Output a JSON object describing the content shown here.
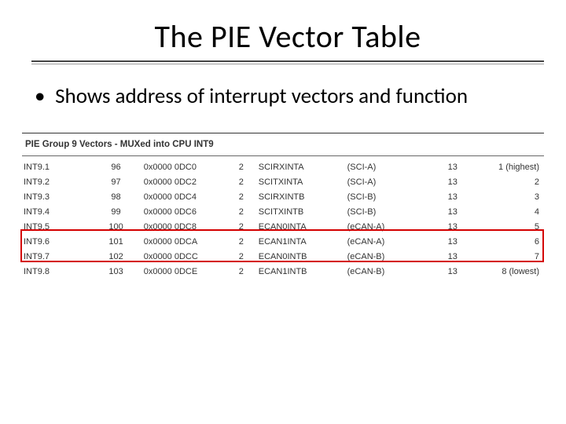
{
  "title": "The PIE Vector Table",
  "bullet_text": "Shows address of interrupt vectors and function",
  "group_header": "PIE Group 9 Vectors - MUXed into CPU INT9",
  "rows": [
    {
      "name": "INT9.1",
      "id": "96",
      "addr": "0x0000 0DC0",
      "size": "2",
      "sig": "SCIRXINTA",
      "periph": "(SCI-A)",
      "grp": "13",
      "prio": "1 (highest)"
    },
    {
      "name": "INT9.2",
      "id": "97",
      "addr": "0x0000 0DC2",
      "size": "2",
      "sig": "SCITXINTA",
      "periph": "(SCI-A)",
      "grp": "13",
      "prio": "2"
    },
    {
      "name": "INT9.3",
      "id": "98",
      "addr": "0x0000 0DC4",
      "size": "2",
      "sig": "SCIRXINTB",
      "periph": "(SCI-B)",
      "grp": "13",
      "prio": "3"
    },
    {
      "name": "INT9.4",
      "id": "99",
      "addr": "0x0000 0DC6",
      "size": "2",
      "sig": "SCITXINTB",
      "periph": "(SCI-B)",
      "grp": "13",
      "prio": "4"
    },
    {
      "name": "INT9.5",
      "id": "100",
      "addr": "0x0000 0DC8",
      "size": "2",
      "sig": "ECAN0INTA",
      "periph": "(eCAN-A)",
      "grp": "13",
      "prio": "5"
    },
    {
      "name": "INT9.6",
      "id": "101",
      "addr": "0x0000 0DCA",
      "size": "2",
      "sig": "ECAN1INTA",
      "periph": "(eCAN-A)",
      "grp": "13",
      "prio": "6"
    },
    {
      "name": "INT9.7",
      "id": "102",
      "addr": "0x0000 0DCC",
      "size": "2",
      "sig": "ECAN0INTB",
      "periph": "(eCAN-B)",
      "grp": "13",
      "prio": "7"
    },
    {
      "name": "INT9.8",
      "id": "103",
      "addr": "0x0000 0DCE",
      "size": "2",
      "sig": "ECAN1INTB",
      "periph": "(eCAN-B)",
      "grp": "13",
      "prio": "8 (lowest)"
    }
  ]
}
